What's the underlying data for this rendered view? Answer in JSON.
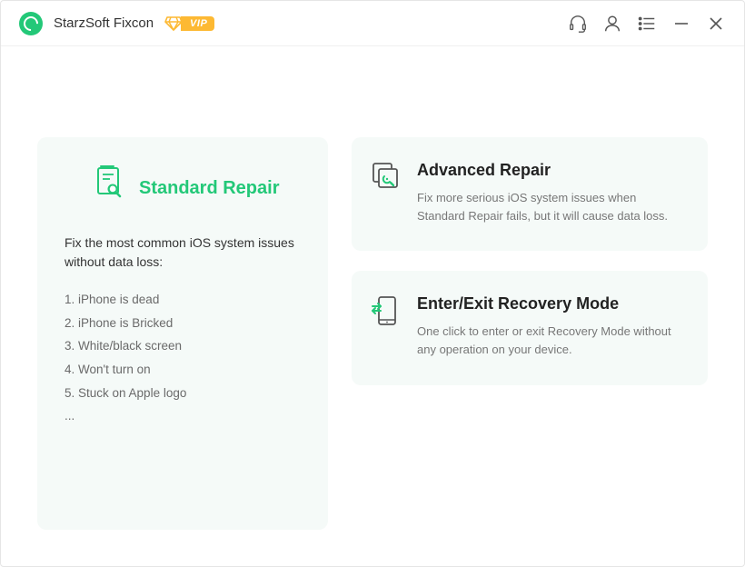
{
  "app": {
    "title": "StarzSoft Fixcon",
    "vip_label": "VIP"
  },
  "standard": {
    "title": "Standard Repair",
    "desc": "Fix the most common iOS system issues without data loss:",
    "issues": {
      "i1": "1. iPhone is dead",
      "i2": "2. iPhone is Bricked",
      "i3": "3. White/black screen",
      "i4": "4. Won't turn on",
      "i5": "5. Stuck on Apple logo",
      "more": "..."
    }
  },
  "advanced": {
    "title": "Advanced Repair",
    "desc": "Fix more serious iOS system issues when Standard Repair fails, but it will cause data loss."
  },
  "recovery": {
    "title": "Enter/Exit Recovery Mode",
    "desc": "One click to enter or exit Recovery Mode without any operation on your device."
  }
}
